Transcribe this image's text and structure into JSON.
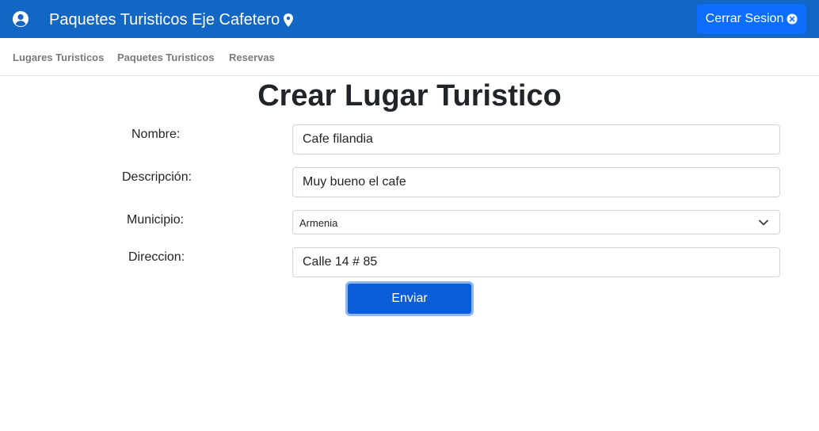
{
  "app": {
    "title": "Paquetes Turisticos Eje Cafetero",
    "logout_label": "Cerrar Sesion",
    "colors": {
      "topbar": "#1266c4",
      "primary": "#0d6efd",
      "submit": "#0b5ed7"
    }
  },
  "icons": {
    "user": "user-circle-icon",
    "location": "map-pin-icon",
    "logout": "close-circle-icon",
    "dropdown": "chevron-down-icon"
  },
  "nav": {
    "items": [
      {
        "label": "Lugares Turisticos"
      },
      {
        "label": "Paquetes Turisticos"
      },
      {
        "label": "Reservas"
      }
    ]
  },
  "form": {
    "heading": "Crear Lugar Turistico",
    "nombre": {
      "label": "Nombre:",
      "value": "Cafe filandia"
    },
    "descripcion": {
      "label": "Descripción:",
      "value": "Muy bueno el cafe"
    },
    "municipio": {
      "label": "Municipio:",
      "selected": "Armenia"
    },
    "direccion": {
      "label": "Direccion:",
      "value": "Calle 14 # 85"
    },
    "submit_label": "Enviar"
  }
}
